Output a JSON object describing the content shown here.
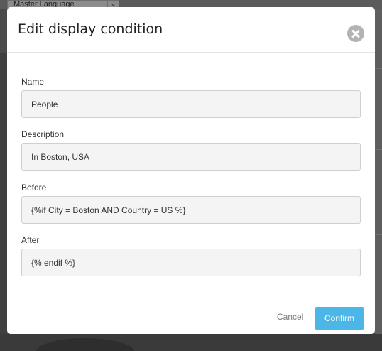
{
  "background": {
    "language_select": {
      "value": "Master Language"
    }
  },
  "dialog": {
    "title": "Edit display condition",
    "fields": {
      "name": {
        "label": "Name",
        "value": "People"
      },
      "description": {
        "label": "Description",
        "value": "In Boston, USA"
      },
      "before": {
        "label": "Before",
        "value": "{%if City = Boston AND Country = US %}"
      },
      "after": {
        "label": "After",
        "value": "{% endif %}"
      }
    },
    "footer": {
      "cancel_label": "Cancel",
      "confirm_label": "Confirm"
    }
  },
  "colors": {
    "accent": "#4cb6e6",
    "overlay": "#4a4a4a"
  }
}
